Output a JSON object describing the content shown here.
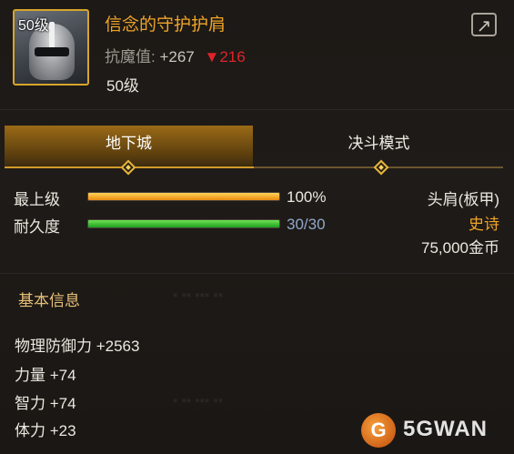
{
  "item": {
    "icon_level_badge": "50级",
    "name": "信念的守护护肩",
    "stat_label": "抗魔值:",
    "stat_value": "+267",
    "stat_diff": "▼216",
    "required_level": "50级",
    "icon": "shoulder-helm-icon",
    "name_color": "#f0a428"
  },
  "share": {
    "icon": "share-icon"
  },
  "tabs": [
    {
      "label": "地下城",
      "active": true
    },
    {
      "label": "决斗模式",
      "active": false
    }
  ],
  "progress": {
    "upgrade": {
      "label": "最上级",
      "value": "100%",
      "fraction": 1.0
    },
    "durability": {
      "label": "耐久度",
      "value": "30/30",
      "fraction": 1.0
    }
  },
  "right_info": {
    "slot": "头肩(板甲)",
    "rarity": "史诗",
    "rarity_color": "#f0a428",
    "price": "75,000金币"
  },
  "basic_info": {
    "title": "基本信息",
    "attributes": [
      "物理防御力 +2563",
      "力量 +74",
      "智力 +74",
      "体力 +23"
    ]
  },
  "watermark": {
    "logo": "G",
    "text": "5GWAN"
  }
}
